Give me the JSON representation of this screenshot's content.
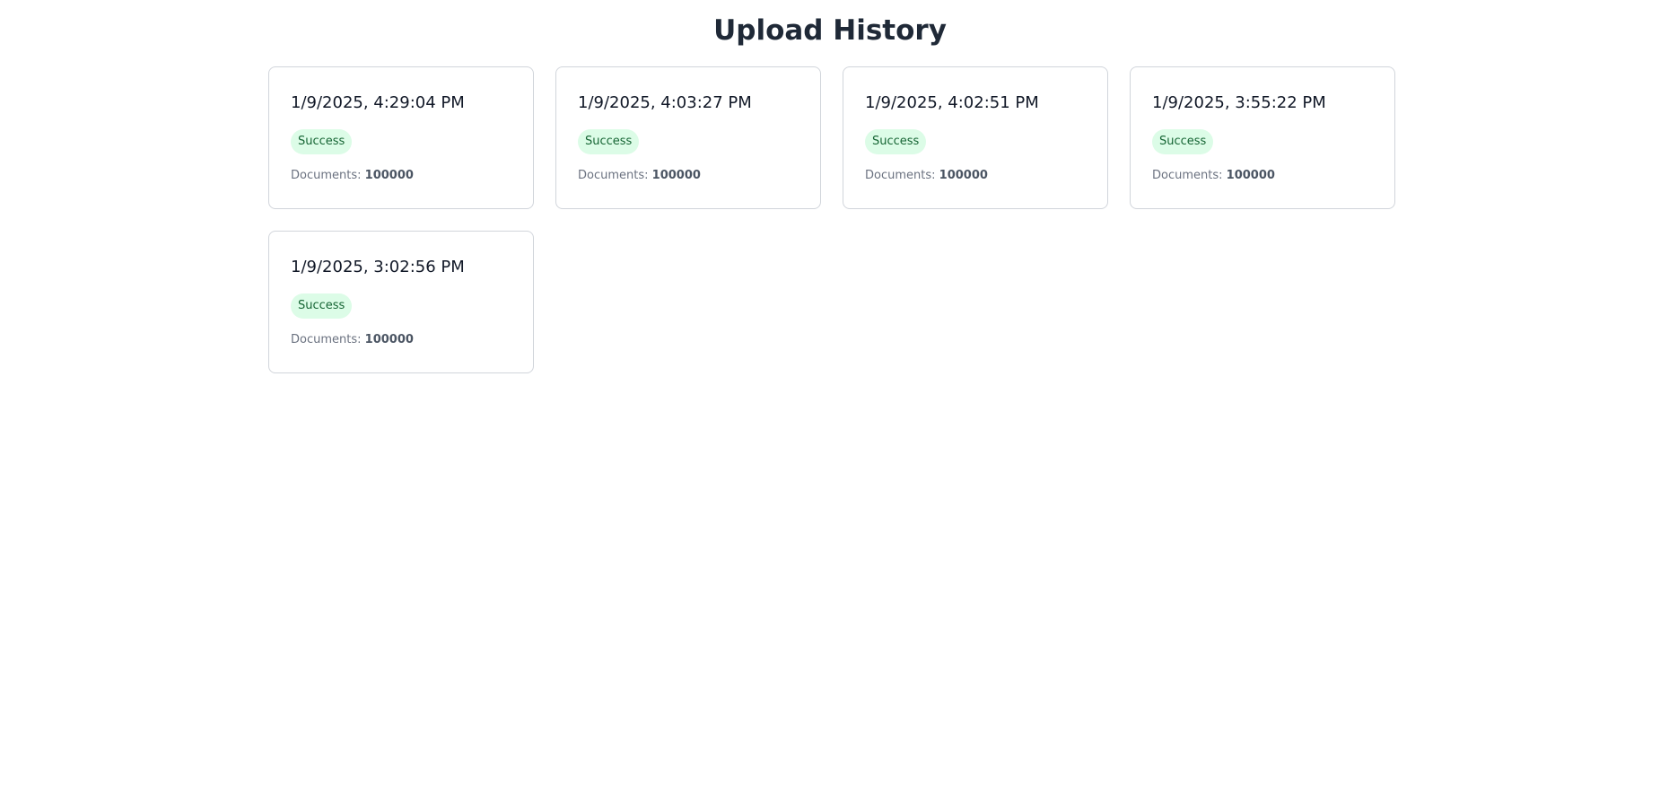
{
  "header": {
    "title": "Upload History"
  },
  "colors": {
    "title": "#1f2937",
    "badge_bg": "#dcfce7",
    "badge_text": "#166534",
    "card_border": "#d1d5db"
  },
  "uploads": [
    {
      "timestamp": "1/9/2025, 4:29:04 PM",
      "status": "Success",
      "documents_label": "Documents:",
      "documents_count": "100000"
    },
    {
      "timestamp": "1/9/2025, 4:03:27 PM",
      "status": "Success",
      "documents_label": "Documents:",
      "documents_count": "100000"
    },
    {
      "timestamp": "1/9/2025, 4:02:51 PM",
      "status": "Success",
      "documents_label": "Documents:",
      "documents_count": "100000"
    },
    {
      "timestamp": "1/9/2025, 3:55:22 PM",
      "status": "Success",
      "documents_label": "Documents:",
      "documents_count": "100000"
    },
    {
      "timestamp": "1/9/2025, 3:02:56 PM",
      "status": "Success",
      "documents_label": "Documents:",
      "documents_count": "100000"
    }
  ]
}
